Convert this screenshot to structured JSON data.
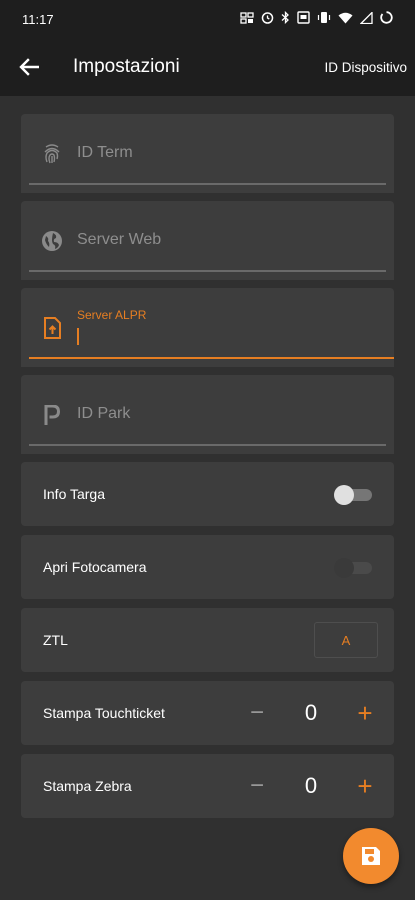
{
  "status_bar": {
    "time": "11:17"
  },
  "app_bar": {
    "title": "Impostazioni",
    "action_label": "ID Dispositivo"
  },
  "fields": {
    "id_term": {
      "placeholder": "ID Term"
    },
    "server_web": {
      "placeholder": "Server Web"
    },
    "server_alpr": {
      "label": "Server ALPR",
      "value": ""
    },
    "id_park": {
      "placeholder": "ID Park"
    }
  },
  "settings": {
    "info_targa": {
      "label": "Info Targa",
      "enabled": false
    },
    "apri_fotocamera": {
      "label": "Apri Fotocamera",
      "enabled": false,
      "disabled": true
    },
    "ztl": {
      "label": "ZTL",
      "value": "A"
    },
    "stampa_touchticket": {
      "label": "Stampa Touchticket",
      "value": "0",
      "minus": "−",
      "plus": "+"
    },
    "stampa_zebra": {
      "label": "Stampa Zebra",
      "value": "0",
      "minus": "−",
      "plus": "+"
    }
  },
  "colors": {
    "accent": "#e67e22",
    "background": "#303030",
    "card": "#3d3d3d",
    "appbar": "#1e1e1e"
  },
  "icons": [
    "fingerprint-icon",
    "globe-icon",
    "upload-file-icon",
    "parking-icon",
    "save-icon",
    "back-arrow-icon"
  ]
}
